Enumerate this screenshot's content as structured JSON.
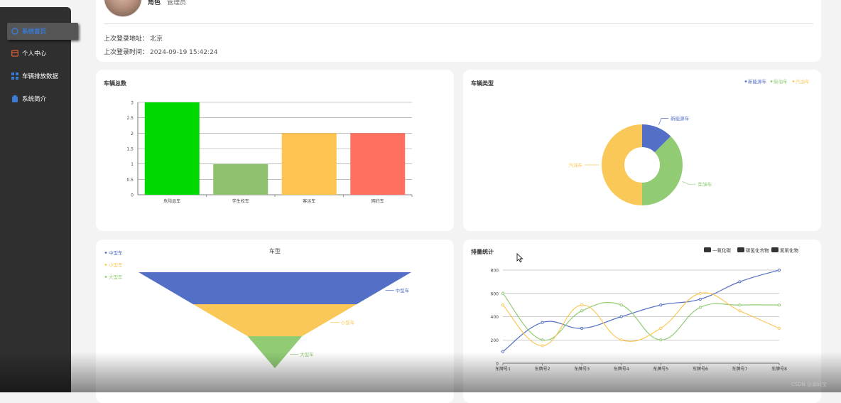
{
  "sidebar": {
    "items": [
      {
        "label": "系统首页",
        "icon": "home-icon",
        "color": "#3a7bd5"
      },
      {
        "label": "个人中心",
        "icon": "user-card-icon",
        "color": "#e0623a"
      },
      {
        "label": "车辆排放数据",
        "icon": "grid-icon",
        "color": "#3a7bd5"
      },
      {
        "label": "系统简介",
        "icon": "clipboard-icon",
        "color": "#3a7bd5"
      }
    ]
  },
  "profile": {
    "role_label": "角色",
    "role_value": "管理员",
    "last_login_addr_label": "上次登录地址：",
    "last_login_addr": "北京",
    "last_login_time_label": "上次登录时间：",
    "last_login_time": "2024-09-19 15:42:24"
  },
  "charts": {
    "total_title": "车辆总数",
    "type_title": "车辆类型",
    "model_title": "车型",
    "emission_title": "排量统计"
  },
  "watermark": "CSDN @源码宝",
  "chart_data": [
    {
      "type": "bar",
      "title": "车辆总数",
      "categories": [
        "危险品车",
        "学生校车",
        "客运车",
        "网约车"
      ],
      "values": [
        3,
        1,
        2,
        2
      ],
      "colors": [
        "#00d900",
        "#8fc16e",
        "#ffc44f",
        "#ff7060"
      ],
      "ylim": [
        0,
        3
      ],
      "yticks": [
        "0",
        "0.5",
        "1",
        "1.5",
        "2",
        "2.5",
        "3"
      ],
      "grid": true
    },
    {
      "type": "pie",
      "title": "车辆类型",
      "labels": [
        "新能源车",
        "柴油车",
        "汽油车"
      ],
      "values": [
        1,
        3,
        4
      ],
      "colors": [
        "#5470c6",
        "#91cc75",
        "#fac858"
      ],
      "legend": "top-right",
      "donut": true
    },
    {
      "type": "funnel",
      "title": "车型",
      "labels": [
        "中型车",
        "小型车",
        "大型车"
      ],
      "values": [
        100,
        60,
        20
      ],
      "colors": [
        "#5470c6",
        "#fac858",
        "#91cc75"
      ],
      "legend": "top-left"
    },
    {
      "type": "line",
      "title": "排量统计",
      "categories": [
        "车牌号1",
        "车牌号2",
        "车牌号3",
        "车牌号4",
        "车牌号5",
        "车牌号6",
        "车牌号7",
        "车牌号8"
      ],
      "series": [
        {
          "name": "一氧化碳",
          "values": [
            100,
            350,
            300,
            400,
            500,
            550,
            700,
            800
          ],
          "color": "#5470c6"
        },
        {
          "name": "碳氢化合物",
          "values": [
            600,
            200,
            450,
            500,
            200,
            480,
            500,
            500
          ],
          "color": "#91cc75"
        },
        {
          "name": "氮氧化物",
          "values": [
            500,
            150,
            500,
            200,
            300,
            600,
            450,
            300
          ],
          "color": "#fac858"
        }
      ],
      "ylim": [
        0,
        800
      ],
      "yticks": [
        "0",
        "200",
        "400",
        "600",
        "800"
      ],
      "legend": "top-right",
      "legend_swatch_color": "#333333",
      "grid": true
    }
  ]
}
